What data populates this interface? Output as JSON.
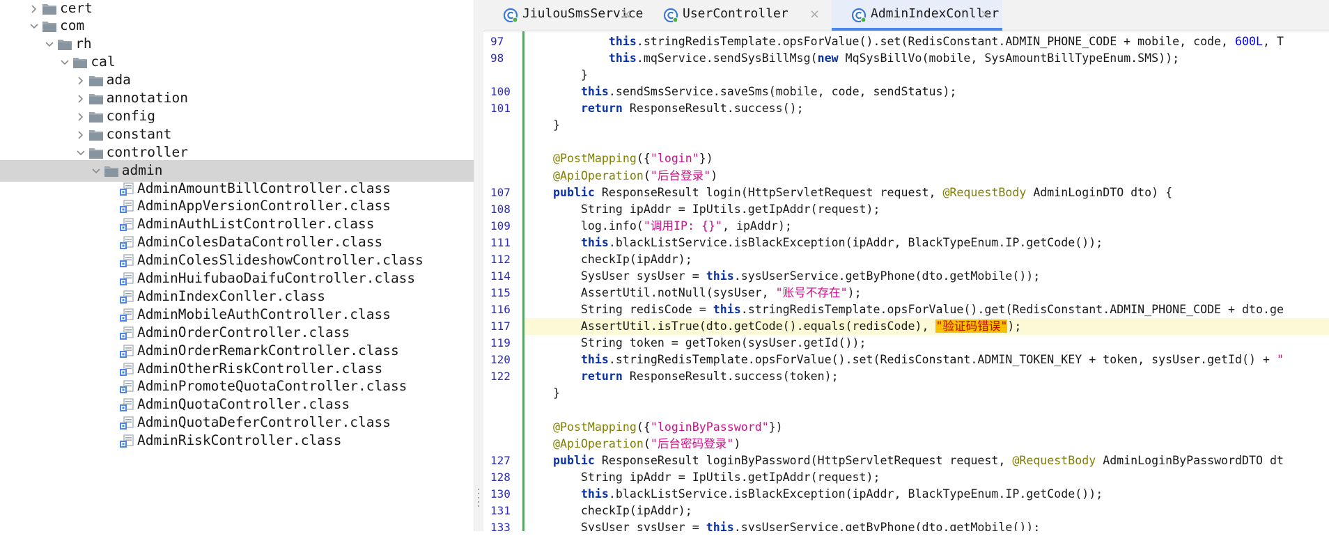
{
  "tree": {
    "nodes": [
      {
        "label": "cert",
        "indent": 0,
        "kind": "folder",
        "expanded": false
      },
      {
        "label": "com",
        "indent": 0,
        "kind": "folder",
        "expanded": true
      },
      {
        "label": "rh",
        "indent": 1,
        "kind": "folder",
        "expanded": true
      },
      {
        "label": "cal",
        "indent": 2,
        "kind": "folder",
        "expanded": true
      },
      {
        "label": "ada",
        "indent": 3,
        "kind": "folder",
        "expanded": false
      },
      {
        "label": "annotation",
        "indent": 3,
        "kind": "folder",
        "expanded": false
      },
      {
        "label": "config",
        "indent": 3,
        "kind": "folder",
        "expanded": false
      },
      {
        "label": "constant",
        "indent": 3,
        "kind": "folder",
        "expanded": false
      },
      {
        "label": "controller",
        "indent": 3,
        "kind": "folder",
        "expanded": true
      },
      {
        "label": "admin",
        "indent": 4,
        "kind": "folder",
        "expanded": true,
        "selected": true
      },
      {
        "label": "AdminAmountBillController.class",
        "indent": 5,
        "kind": "class"
      },
      {
        "label": "AdminAppVersionController.class",
        "indent": 5,
        "kind": "class"
      },
      {
        "label": "AdminAuthListController.class",
        "indent": 5,
        "kind": "class"
      },
      {
        "label": "AdminColesDataController.class",
        "indent": 5,
        "kind": "class"
      },
      {
        "label": "AdminColesSlideshowController.class",
        "indent": 5,
        "kind": "class"
      },
      {
        "label": "AdminHuifubaoDaifuController.class",
        "indent": 5,
        "kind": "class"
      },
      {
        "label": "AdminIndexConller.class",
        "indent": 5,
        "kind": "class"
      },
      {
        "label": "AdminMobileAuthController.class",
        "indent": 5,
        "kind": "class"
      },
      {
        "label": "AdminOrderController.class",
        "indent": 5,
        "kind": "class"
      },
      {
        "label": "AdminOrderRemarkController.class",
        "indent": 5,
        "kind": "class"
      },
      {
        "label": "AdminOtherRiskController.class",
        "indent": 5,
        "kind": "class"
      },
      {
        "label": "AdminPromoteQuotaController.class",
        "indent": 5,
        "kind": "class"
      },
      {
        "label": "AdminQuotaController.class",
        "indent": 5,
        "kind": "class"
      },
      {
        "label": "AdminQuotaDeferController.class",
        "indent": 5,
        "kind": "class"
      },
      {
        "label": "AdminRiskController.class",
        "indent": 5,
        "kind": "class"
      }
    ]
  },
  "tabs": [
    {
      "name": "JiulouSmsService",
      "active": false
    },
    {
      "name": "UserController",
      "active": false
    },
    {
      "name": "AdminIndexConller",
      "active": true
    }
  ],
  "tab_close_glyph": "×",
  "editor": {
    "lines": [
      {
        "num": "97",
        "highlight": false,
        "tokens": [
          [
            "p",
            "            "
          ],
          [
            "k",
            "this"
          ],
          [
            "p",
            ".stringRedisTemplate.opsForValue().set(RedisConstant.ADMIN_PHONE_CODE + mobile, code, "
          ],
          [
            "n",
            "600L"
          ],
          [
            "p",
            ", T"
          ]
        ]
      },
      {
        "num": "98",
        "highlight": false,
        "tokens": [
          [
            "p",
            "            "
          ],
          [
            "k",
            "this"
          ],
          [
            "p",
            ".mqService.sendSysBillMsg("
          ],
          [
            "k",
            "new"
          ],
          [
            "p",
            " MqSysBillVo(mobile, SysAmountBillTypeEnum.SMS));"
          ]
        ]
      },
      {
        "num": "",
        "highlight": false,
        "tokens": [
          [
            "p",
            "        }"
          ]
        ]
      },
      {
        "num": "100",
        "highlight": false,
        "tokens": [
          [
            "p",
            "        "
          ],
          [
            "k",
            "this"
          ],
          [
            "p",
            ".sendSmsService.saveSms(mobile, code, sendStatus);"
          ]
        ]
      },
      {
        "num": "101",
        "highlight": false,
        "tokens": [
          [
            "p",
            "        "
          ],
          [
            "k",
            "return"
          ],
          [
            "p",
            " ResponseResult.success();"
          ]
        ]
      },
      {
        "num": "",
        "highlight": false,
        "tokens": [
          [
            "p",
            "    }"
          ]
        ]
      },
      {
        "num": "",
        "highlight": false,
        "tokens": []
      },
      {
        "num": "",
        "highlight": false,
        "tokens": [
          [
            "p",
            "    "
          ],
          [
            "a",
            "@PostMapping"
          ],
          [
            "p",
            "({"
          ],
          [
            "s",
            "\"login\""
          ],
          [
            "p",
            "})"
          ]
        ]
      },
      {
        "num": "",
        "highlight": false,
        "tokens": [
          [
            "p",
            "    "
          ],
          [
            "a",
            "@ApiOperation"
          ],
          [
            "p",
            "("
          ],
          [
            "s",
            "\"后台登录\""
          ],
          [
            "p",
            ")"
          ]
        ]
      },
      {
        "num": "107",
        "highlight": false,
        "tokens": [
          [
            "p",
            "    "
          ],
          [
            "k",
            "public"
          ],
          [
            "p",
            " ResponseResult login(HttpServletRequest request, "
          ],
          [
            "a",
            "@RequestBody"
          ],
          [
            "p",
            " AdminLoginDTO dto) {"
          ]
        ]
      },
      {
        "num": "108",
        "highlight": false,
        "tokens": [
          [
            "p",
            "        String ipAddr = IpUtils.getIpAddr(request);"
          ]
        ]
      },
      {
        "num": "109",
        "highlight": false,
        "tokens": [
          [
            "p",
            "        log.info("
          ],
          [
            "s",
            "\"调用IP: {}\""
          ],
          [
            "p",
            ", ipAddr);"
          ]
        ]
      },
      {
        "num": "111",
        "highlight": false,
        "tokens": [
          [
            "p",
            "        "
          ],
          [
            "k",
            "this"
          ],
          [
            "p",
            ".blackListService.isBlackException(ipAddr, BlackTypeEnum.IP.getCode());"
          ]
        ]
      },
      {
        "num": "112",
        "highlight": false,
        "tokens": [
          [
            "p",
            "        checkIp(ipAddr);"
          ]
        ]
      },
      {
        "num": "114",
        "highlight": false,
        "tokens": [
          [
            "p",
            "        SysUser sysUser = "
          ],
          [
            "k",
            "this"
          ],
          [
            "p",
            ".sysUserService.getByPhone(dto.getMobile());"
          ]
        ]
      },
      {
        "num": "115",
        "highlight": false,
        "tokens": [
          [
            "p",
            "        AssertUtil.notNull(sysUser, "
          ],
          [
            "s",
            "\"账号不存在\""
          ],
          [
            "p",
            ");"
          ]
        ]
      },
      {
        "num": "116",
        "highlight": false,
        "tokens": [
          [
            "p",
            "        String redisCode = "
          ],
          [
            "k",
            "this"
          ],
          [
            "p",
            ".stringRedisTemplate.opsForValue().get(RedisConstant.ADMIN_PHONE_CODE + dto.ge"
          ]
        ]
      },
      {
        "num": "117",
        "highlight": true,
        "tokens": [
          [
            "p",
            "        AssertUtil.isTrue(dto.getCode().equals(redisCode), "
          ],
          [
            "h",
            "\"验证码错误\""
          ],
          [
            "p",
            ");"
          ]
        ]
      },
      {
        "num": "119",
        "highlight": false,
        "tokens": [
          [
            "p",
            "        String token = getToken(sysUser.getId());"
          ]
        ]
      },
      {
        "num": "120",
        "highlight": false,
        "tokens": [
          [
            "p",
            "        "
          ],
          [
            "k",
            "this"
          ],
          [
            "p",
            ".stringRedisTemplate.opsForValue().set(RedisConstant.ADMIN_TOKEN_KEY + token, sysUser.getId() + "
          ],
          [
            "s",
            "\""
          ]
        ]
      },
      {
        "num": "122",
        "highlight": false,
        "tokens": [
          [
            "p",
            "        "
          ],
          [
            "k",
            "return"
          ],
          [
            "p",
            " ResponseResult.success(token);"
          ]
        ]
      },
      {
        "num": "",
        "highlight": false,
        "tokens": [
          [
            "p",
            "    }"
          ]
        ]
      },
      {
        "num": "",
        "highlight": false,
        "tokens": []
      },
      {
        "num": "",
        "highlight": false,
        "tokens": [
          [
            "p",
            "    "
          ],
          [
            "a",
            "@PostMapping"
          ],
          [
            "p",
            "({"
          ],
          [
            "s",
            "\"loginByPassword\""
          ],
          [
            "p",
            "})"
          ]
        ]
      },
      {
        "num": "",
        "highlight": false,
        "tokens": [
          [
            "p",
            "    "
          ],
          [
            "a",
            "@ApiOperation"
          ],
          [
            "p",
            "("
          ],
          [
            "s",
            "\"后台密码登录\""
          ],
          [
            "p",
            ")"
          ]
        ]
      },
      {
        "num": "127",
        "highlight": false,
        "tokens": [
          [
            "p",
            "    "
          ],
          [
            "k",
            "public"
          ],
          [
            "p",
            " ResponseResult loginByPassword(HttpServletRequest request, "
          ],
          [
            "a",
            "@RequestBody"
          ],
          [
            "p",
            " AdminLoginByPasswordDTO dt"
          ]
        ]
      },
      {
        "num": "128",
        "highlight": false,
        "tokens": [
          [
            "p",
            "        String ipAddr = IpUtils.getIpAddr(request);"
          ]
        ]
      },
      {
        "num": "130",
        "highlight": false,
        "tokens": [
          [
            "p",
            "        "
          ],
          [
            "k",
            "this"
          ],
          [
            "p",
            ".blackListService.isBlackException(ipAddr, BlackTypeEnum.IP.getCode());"
          ]
        ]
      },
      {
        "num": "131",
        "highlight": false,
        "tokens": [
          [
            "p",
            "        checkIp(ipAddr);"
          ]
        ]
      },
      {
        "num": "133",
        "highlight": false,
        "tokens": [
          [
            "p",
            "        SysUser sysUser = "
          ],
          [
            "k",
            "this"
          ],
          [
            "p",
            ".sysUserService.getByPhone(dto.getMobile());"
          ]
        ]
      }
    ]
  },
  "colors": {
    "keyword": "#0b33a8",
    "string": "#d10f8a",
    "annotation": "#808000",
    "number": "#0000ff",
    "line_number": "#2b2bb5",
    "gutter_change": "#59a869",
    "current_line": "#fcfad6",
    "search_match": "#f9c000",
    "active_tab_underline": "#4a86e8"
  }
}
